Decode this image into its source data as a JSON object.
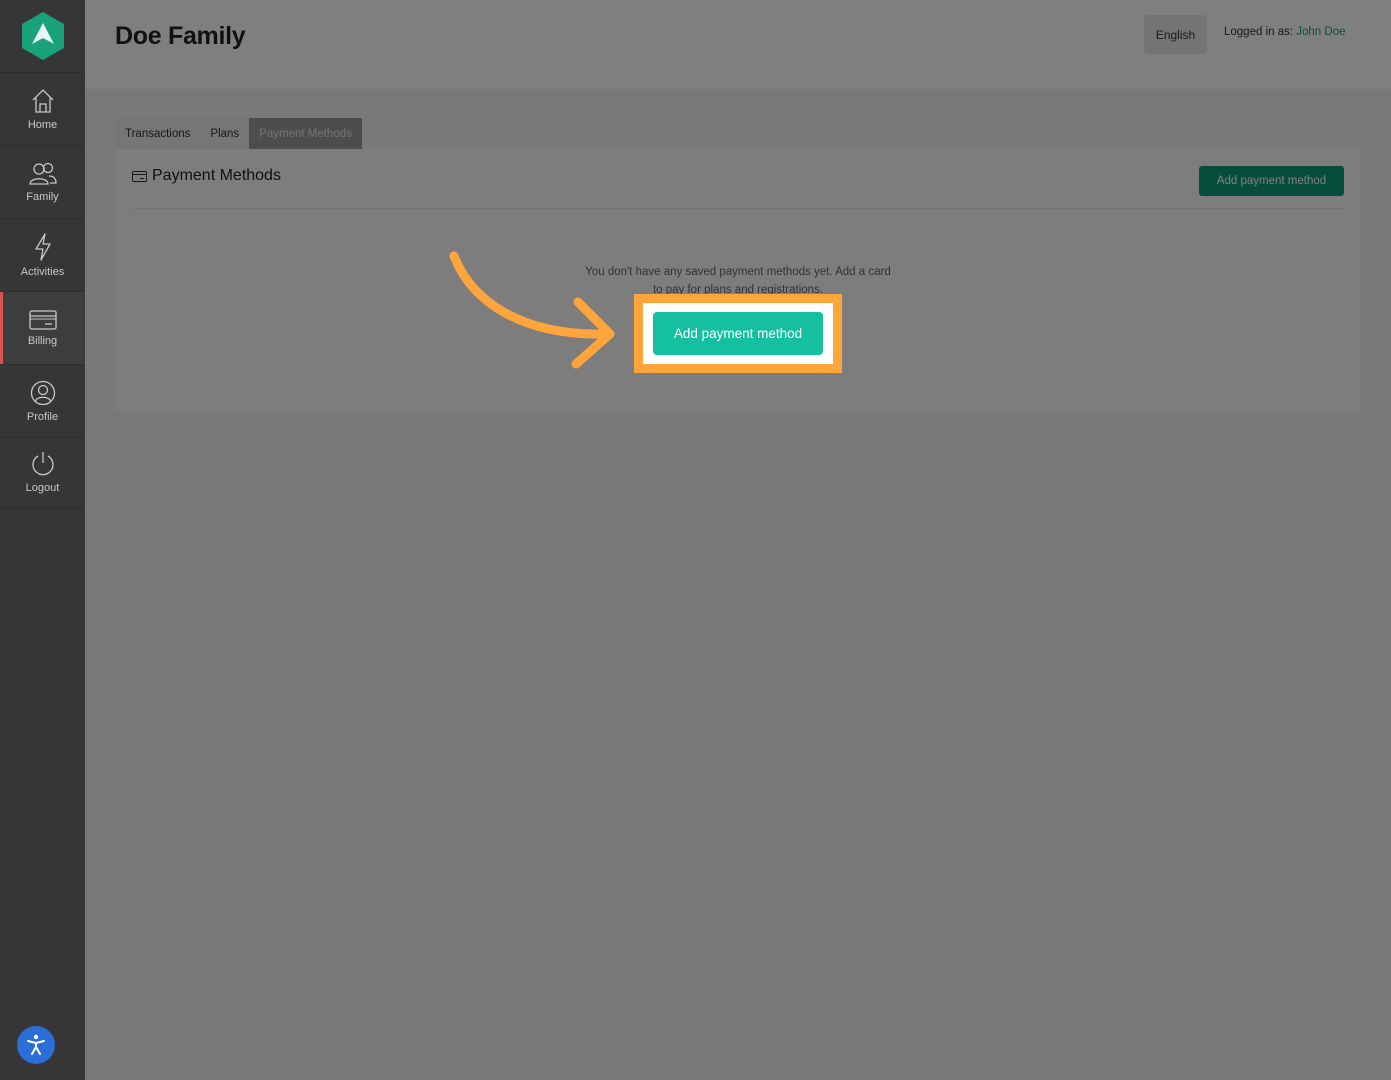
{
  "app": {
    "page_title": "Doe Family",
    "language": "English",
    "logged_in_label": "Logged in as:",
    "user_name": "John Doe"
  },
  "sidebar": {
    "items": [
      {
        "label": "Home",
        "icon": "home-icon"
      },
      {
        "label": "Family",
        "icon": "family-icon"
      },
      {
        "label": "Activities",
        "icon": "activities-icon"
      },
      {
        "label": "Billing",
        "icon": "billing-icon",
        "active": true
      },
      {
        "label": "Profile",
        "icon": "profile-icon"
      },
      {
        "label": "Logout",
        "icon": "power-icon"
      }
    ]
  },
  "tabs": [
    {
      "label": "Transactions"
    },
    {
      "label": "Plans"
    },
    {
      "label": "Payment Methods",
      "active": true
    }
  ],
  "payment_methods": {
    "title": "Payment Methods",
    "add_button_label": "Add payment method",
    "empty_message": "You don't have any saved payment methods yet. Add a card to pay for plans and registrations.",
    "cta_label": "Add payment method"
  },
  "colors": {
    "accent": "#14c0a0",
    "highlight": "#ffa53c",
    "sidebar": "#363636"
  }
}
